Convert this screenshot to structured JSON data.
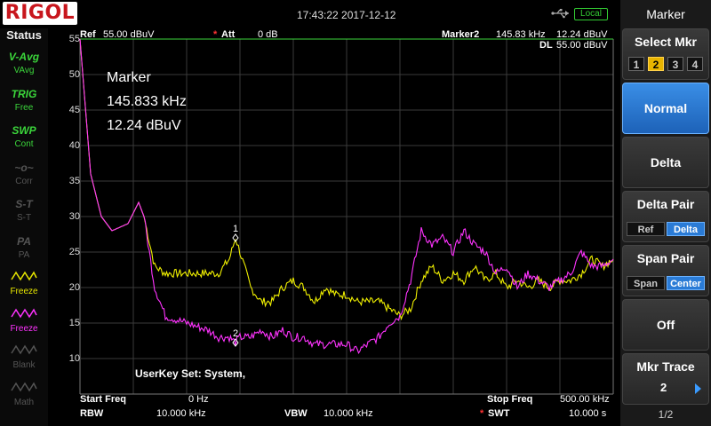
{
  "brand": "RIGOL",
  "datetime": "17:43:22 2017-12-12",
  "local_label": "Local",
  "status": {
    "title": "Status",
    "items": [
      {
        "icon": "V-Avg",
        "label": "VAvg",
        "color": "#3bd63b"
      },
      {
        "icon": "TRIG",
        "label": "Free",
        "color": "#3bd63b"
      },
      {
        "icon": "SWP",
        "label": "Cont",
        "color": "#3bd63b"
      },
      {
        "icon": "~o~",
        "label": "Corr",
        "color": "#555555"
      },
      {
        "icon": "S-T",
        "label": "S-T",
        "color": "#555555"
      },
      {
        "icon": "PA",
        "label": "PA",
        "color": "#555555"
      },
      {
        "icon": "wave",
        "label": "Freeze",
        "color": "#e8e800"
      },
      {
        "icon": "wave",
        "label": "Freeze",
        "color": "#ff33ff"
      },
      {
        "icon": "wave",
        "label": "Blank",
        "color": "#555555"
      },
      {
        "icon": "wave",
        "label": "Math",
        "color": "#555555"
      }
    ]
  },
  "header": {
    "ref_label": "Ref",
    "ref_value": "55.00 dBuV",
    "att_star": "*",
    "att_label": "Att",
    "att_value": "0 dB",
    "marker_label": "Marker2",
    "marker_freq": "145.83 kHz",
    "marker_level": "12.24 dBuV",
    "dl_label": "DL",
    "dl_value": "55.00 dBuV"
  },
  "marker_readout": {
    "title": "Marker",
    "freq": "145.833 kHz",
    "level": "12.24 dBuV"
  },
  "userkey": "UserKey Set:    System,",
  "footer": {
    "start_label": "Start Freq",
    "start_value": "0 Hz",
    "stop_label": "Stop Freq",
    "stop_value": "500.00 kHz",
    "rbw_label": "RBW",
    "rbw_value": "10.000 kHz",
    "vbw_label": "VBW",
    "vbw_value": "10.000 kHz",
    "swt_star": "*",
    "swt_label": "SWT",
    "swt_value": "10.000 s"
  },
  "menu": {
    "title": "Marker",
    "select_mkr": {
      "label": "Select Mkr",
      "options": [
        "1",
        "2",
        "3",
        "4"
      ],
      "selected": 1
    },
    "normal": "Normal",
    "delta": "Delta",
    "delta_pair": {
      "label": "Delta Pair",
      "options": [
        "Ref",
        "Delta"
      ],
      "selected": 1
    },
    "span_pair": {
      "label": "Span Pair",
      "options": [
        "Span",
        "Center"
      ],
      "selected": 1
    },
    "off": "Off",
    "mkr_trace": {
      "label": "Mkr Trace",
      "value": "2"
    },
    "page": "1/2"
  },
  "chart_data": {
    "type": "line",
    "xlim": [
      0,
      500
    ],
    "ylim": [
      5,
      55
    ],
    "xlabel": "",
    "ylabel": "",
    "y_ticks": [
      55,
      50,
      45,
      40,
      35,
      30,
      25,
      20,
      15,
      10
    ],
    "grid": true,
    "series": [
      {
        "color": "#f0f000",
        "x": [
          0,
          10,
          20,
          30,
          45,
          55,
          60,
          70,
          80,
          100,
          120,
          130,
          140,
          145.8,
          150,
          160,
          170,
          180,
          190,
          200,
          210,
          220,
          230,
          240,
          250,
          260,
          270,
          280,
          290,
          300,
          310,
          320,
          330,
          340,
          350,
          360,
          370,
          380,
          390,
          400,
          410,
          420,
          430,
          440,
          450,
          460,
          470,
          480,
          490,
          500
        ],
        "y": [
          55,
          36,
          30,
          28,
          29,
          32,
          30,
          23,
          22,
          22,
          22,
          22,
          24,
          27,
          25,
          20,
          18,
          18,
          20,
          21,
          20,
          18,
          20,
          19,
          19,
          18,
          18,
          18,
          17,
          16,
          17,
          21,
          23,
          21,
          22,
          21,
          23,
          21,
          22,
          20,
          21,
          20,
          21,
          20,
          21,
          21,
          22,
          24,
          23,
          24
        ]
      },
      {
        "color": "#ff33ff",
        "x": [
          0,
          10,
          20,
          30,
          45,
          55,
          60,
          70,
          80,
          100,
          120,
          130,
          140,
          145.8,
          150,
          160,
          170,
          180,
          190,
          200,
          210,
          220,
          230,
          240,
          250,
          260,
          270,
          280,
          290,
          300,
          310,
          320,
          330,
          340,
          350,
          360,
          370,
          380,
          390,
          400,
          410,
          420,
          430,
          440,
          450,
          460,
          470,
          480,
          490,
          500
        ],
        "y": [
          55,
          36,
          30,
          28,
          29,
          32,
          30,
          20,
          16,
          15,
          14,
          13,
          13,
          12.24,
          13,
          13,
          14,
          13,
          14,
          13,
          13,
          12,
          12,
          12,
          12,
          11,
          12,
          13,
          15,
          16,
          21,
          28,
          26,
          27,
          25,
          28,
          26,
          25,
          22,
          23,
          20,
          22,
          21,
          20,
          21,
          22,
          25,
          23,
          23,
          24
        ]
      }
    ],
    "markers": [
      {
        "label": "1",
        "x": 145.8,
        "y": 27
      },
      {
        "label": "2",
        "x": 145.8,
        "y": 12.24
      }
    ]
  }
}
